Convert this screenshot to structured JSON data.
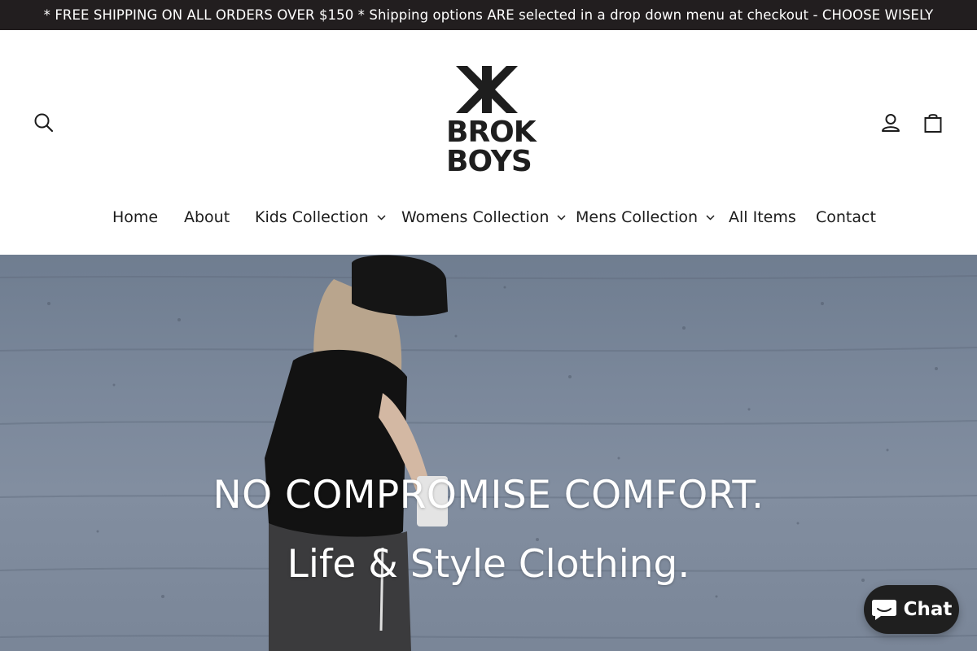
{
  "announcement": {
    "text": "* FREE SHIPPING ON ALL ORDERS OVER $150 * Shipping options ARE selected in a drop down menu at checkout - CHOOSE WISELY"
  },
  "header": {
    "logo_line1": "BROK",
    "logo_line2": "BOYS",
    "icons": [
      "search-icon",
      "account-icon",
      "cart-icon"
    ]
  },
  "nav": {
    "items": [
      {
        "label": "Home",
        "dropdown": false
      },
      {
        "label": "About",
        "dropdown": false
      },
      {
        "label": "Kids Collection",
        "dropdown": true
      },
      {
        "label": "Womens Collection",
        "dropdown": true
      },
      {
        "label": "Mens Collection",
        "dropdown": true
      },
      {
        "label": "All Items",
        "dropdown": false
      },
      {
        "label": "Contact",
        "dropdown": false
      }
    ]
  },
  "hero": {
    "title": "NO COMPROMISE COMFORT.",
    "subtitle": "Life & Style Clothing."
  },
  "chat": {
    "label": "Chat"
  }
}
